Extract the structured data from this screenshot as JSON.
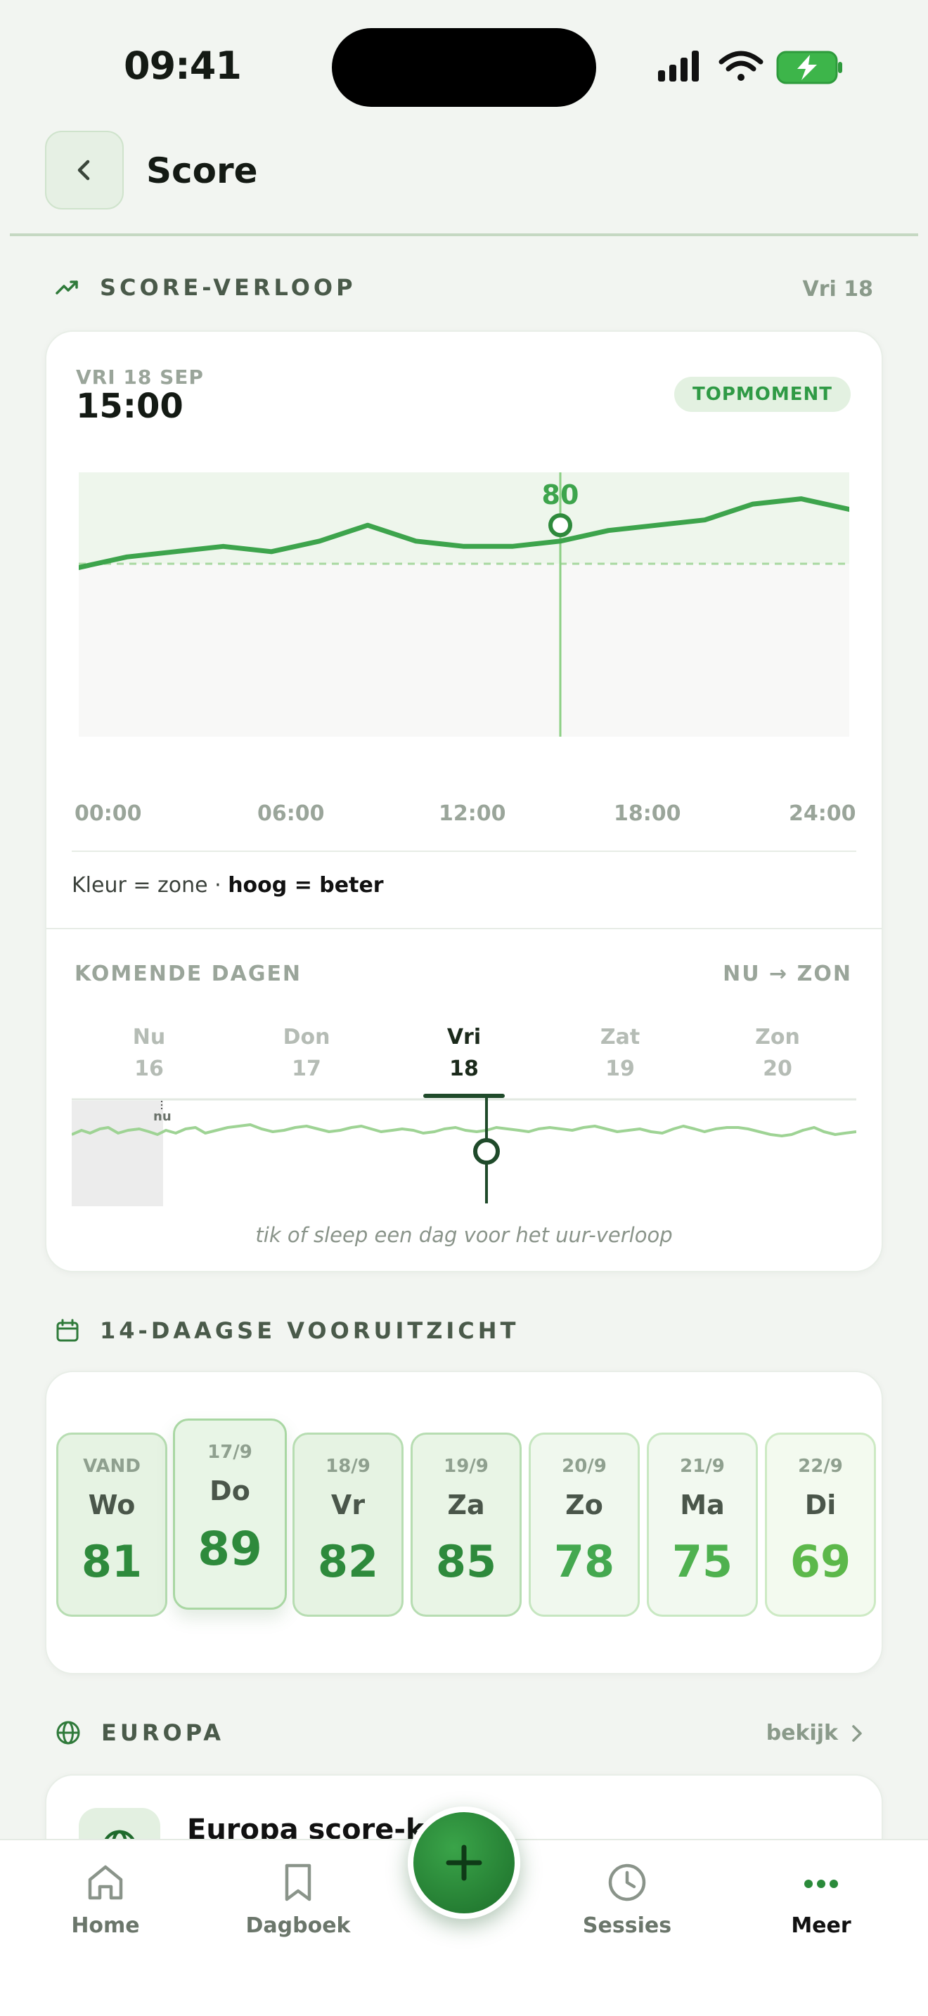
{
  "status": {
    "time": "09:41"
  },
  "header": {
    "title": "Score"
  },
  "score_section": {
    "title": "SCORE-VERLOOP",
    "right": "Vri 18",
    "date_caption": "VRI 18 SEP",
    "time": "15:00",
    "badge": "TOPMOMENT",
    "marker_value": "80",
    "x_labels": [
      "00:00",
      "06:00",
      "12:00",
      "18:00",
      "24:00"
    ],
    "legend_prefix": "Kleur = zone · ",
    "legend_bold": "hoog = beter"
  },
  "chart_data": {
    "type": "line",
    "x": [
      0,
      1.5,
      3,
      4.5,
      6,
      7.5,
      9,
      10.5,
      12,
      13.5,
      15,
      16.5,
      18,
      19.5,
      21,
      22.5,
      24
    ],
    "values": [
      72,
      74,
      75,
      76,
      75,
      77,
      80,
      77,
      76,
      76,
      77,
      79,
      80,
      81,
      84,
      85,
      83
    ],
    "xlabel": "",
    "ylabel": "",
    "x_ticks": [
      "00:00",
      "06:00",
      "12:00",
      "18:00",
      "24:00"
    ],
    "highlight": {
      "x": 15,
      "value": 80
    },
    "grid": false
  },
  "upcoming": {
    "title": "KOMENDE DAGEN",
    "range": "NU → ZON",
    "days": [
      {
        "name": "Nu",
        "num": "16"
      },
      {
        "name": "Don",
        "num": "17"
      },
      {
        "name": "Vri",
        "num": "18"
      },
      {
        "name": "Zat",
        "num": "19"
      },
      {
        "name": "Zon",
        "num": "20"
      }
    ],
    "now_marker": "nu",
    "hint": "tik of sleep een dag voor het uur-verloop"
  },
  "forecast": {
    "title": "14-DAAGSE VOORUITZICHT",
    "tiles": [
      {
        "top": "VAND",
        "day": "Wo",
        "value": "81"
      },
      {
        "top": "17/9",
        "day": "Do",
        "value": "89"
      },
      {
        "top": "18/9",
        "day": "Vr",
        "value": "82"
      },
      {
        "top": "19/9",
        "day": "Za",
        "value": "85"
      },
      {
        "top": "20/9",
        "day": "Zo",
        "value": "78"
      },
      {
        "top": "21/9",
        "day": "Ma",
        "value": "75"
      },
      {
        "top": "22/9",
        "day": "Di",
        "value": "69"
      }
    ]
  },
  "europe": {
    "title": "EUROPA",
    "link": "bekijk",
    "card_title": "Europa score-ka"
  },
  "nav": {
    "home": "Home",
    "diary": "Dagboek",
    "sessions": "Sessies",
    "more": "Meer"
  }
}
